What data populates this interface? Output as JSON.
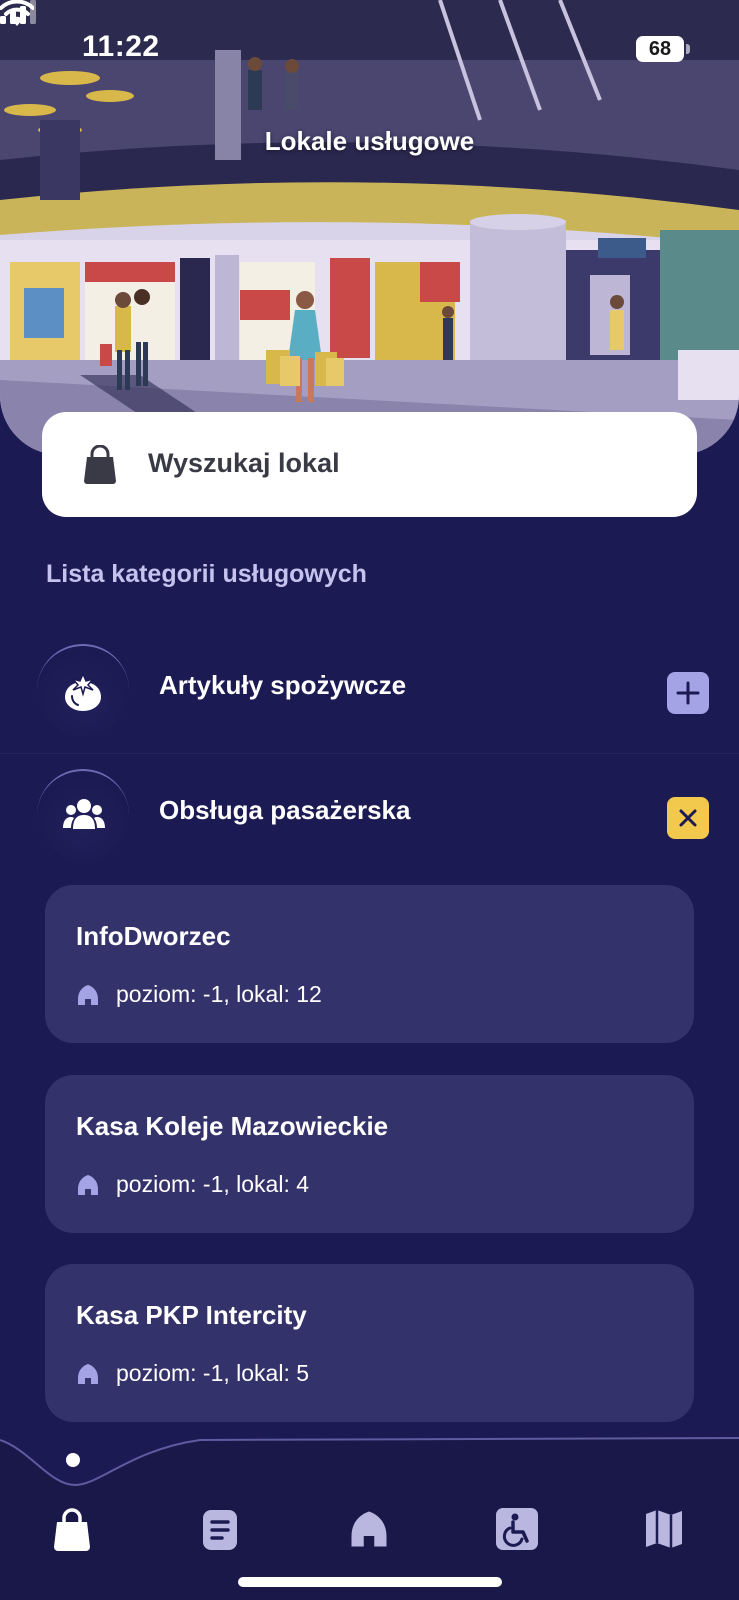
{
  "status_bar": {
    "time": "11:22",
    "battery": "68"
  },
  "header": {
    "title": "Lokale usługowe"
  },
  "search": {
    "placeholder": "Wyszukaj lokal",
    "icon": "shopping-bag-icon"
  },
  "section": {
    "title": "Lista kategorii usługowych"
  },
  "categories": [
    {
      "label": "Artykuły spożywcze",
      "icon": "tomato-icon",
      "state": "collapsed",
      "action_icon": "plus-icon"
    },
    {
      "label": "Obsługa pasażerska",
      "icon": "people-group-icon",
      "state": "expanded",
      "action_icon": "close-icon"
    }
  ],
  "locations": [
    {
      "name": "InfoDworzec",
      "detail": "poziom: -1, lokal: 12"
    },
    {
      "name": "Kasa Koleje Mazowieckie",
      "detail": "poziom: -1, lokal: 4"
    },
    {
      "name": "Kasa PKP Intercity",
      "detail": "poziom: -1, lokal: 5"
    }
  ],
  "bottom_nav": {
    "items": [
      {
        "icon": "shopping-bag-icon",
        "active": true
      },
      {
        "icon": "document-icon",
        "active": false
      },
      {
        "icon": "home-icon",
        "active": false
      },
      {
        "icon": "accessibility-icon",
        "active": false
      },
      {
        "icon": "map-icon",
        "active": false
      }
    ]
  },
  "colors": {
    "background": "#1c1a52",
    "card": "#34326b",
    "accent_plus": "#a3a3e6",
    "accent_close": "#f2c94c"
  }
}
